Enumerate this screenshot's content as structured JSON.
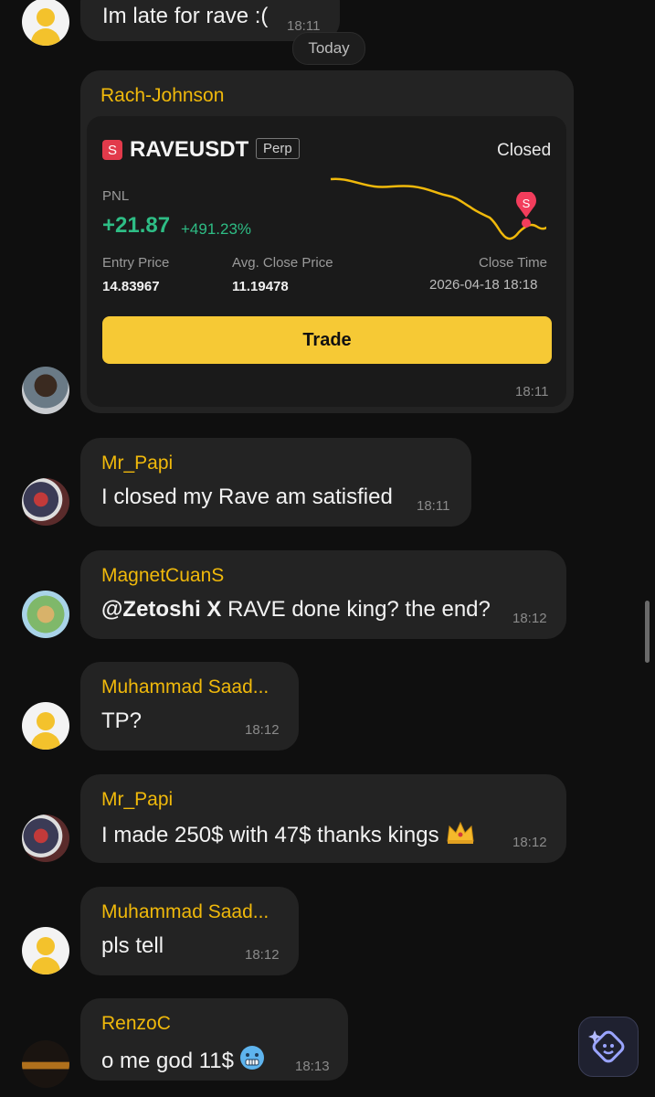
{
  "date_separator": "Today",
  "top_message": {
    "text": "Im late for rave :(",
    "time": "18:11"
  },
  "trade_share": {
    "user": "Rach-Johnson",
    "symbol_icon": "S",
    "symbol": "RAVEUSDT",
    "badge": "Perp",
    "status": "Closed",
    "pnl_label": "PNL",
    "pnl_value": "+21.87",
    "pnl_percent": "+491.23%",
    "entry_label": "Entry Price",
    "entry_value": "14.83967",
    "avg_close_label": "Avg. Close Price",
    "avg_close_value": "11.19478",
    "close_time_label": "Close Time",
    "close_time_value": "2026-04-18 18:18",
    "chart_marker": "S",
    "button_label": "Trade",
    "time": "18:11"
  },
  "messages": [
    {
      "user": "Mr_Papi",
      "text": "I closed my Rave am satisfied",
      "time": "18:11",
      "avatar": "boxing-photo"
    },
    {
      "user": "MagnetCuanS",
      "mention": "@Zetoshi X",
      "text": " RAVE done king? the end?",
      "time": "18:12",
      "avatar": "landscape-photo"
    },
    {
      "user": "Muhammad Saad...",
      "text": "TP?",
      "time": "18:12",
      "avatar": "default-avatar"
    },
    {
      "user": "Mr_Papi",
      "text": "I made 250$ with 47$ thanks kings",
      "emoji": "crown",
      "time": "18:12",
      "avatar": "boxing-photo"
    },
    {
      "user": "Muhammad Saad...",
      "text": "pls tell",
      "time": "18:12",
      "avatar": "default-avatar"
    },
    {
      "user": "RenzoC",
      "text": "o me god 11$",
      "emoji": "freezing-face",
      "time": "18:13",
      "avatar": "logo-photo"
    }
  ],
  "colors": {
    "accent": "#f0b90b",
    "pnl_green": "#2ebd85",
    "bubble": "#232323",
    "background": "#0f0f0f",
    "button": "#f6c935"
  },
  "floating_button_icon": "ai-sparkle-icon"
}
